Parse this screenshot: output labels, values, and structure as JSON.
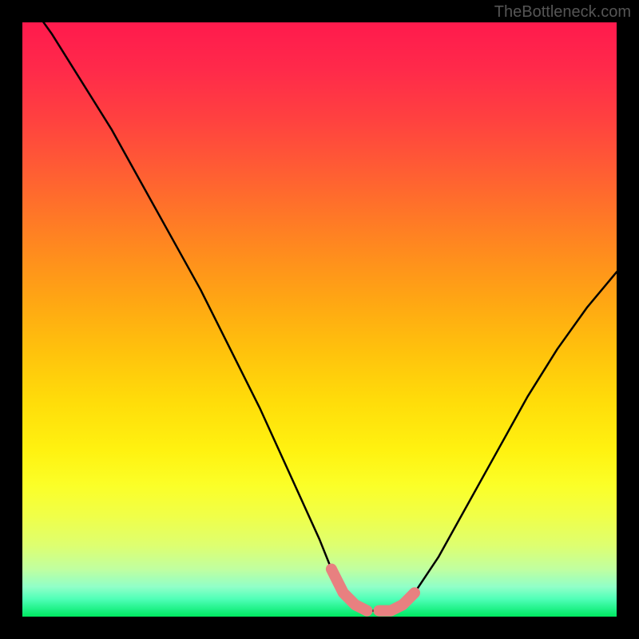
{
  "attribution": "TheBottleneck.com",
  "chart_data": {
    "type": "line",
    "title": "",
    "xlabel": "",
    "ylabel": "",
    "xlim": [
      0,
      100
    ],
    "ylim": [
      0,
      100
    ],
    "series": [
      {
        "name": "bottleneck-curve",
        "x": [
          0,
          5,
          10,
          15,
          20,
          25,
          30,
          35,
          40,
          45,
          50,
          52,
          54,
          56,
          58,
          60,
          62,
          64,
          66,
          70,
          75,
          80,
          85,
          90,
          95,
          100
        ],
        "values": [
          105,
          98,
          90,
          82,
          73,
          64,
          55,
          45,
          35,
          24,
          13,
          8,
          4,
          2,
          1,
          1,
          1,
          2,
          4,
          10,
          19,
          28,
          37,
          45,
          52,
          58
        ]
      },
      {
        "name": "optimal-highlight",
        "x": [
          52,
          54,
          56,
          58,
          60,
          62,
          64,
          66
        ],
        "values": [
          8,
          4,
          2,
          1,
          1,
          1,
          2,
          4
        ]
      }
    ],
    "optimal_x": 59,
    "colors": {
      "curve": "#000000",
      "highlight": "#e88080",
      "background_top": "#ff1a4d",
      "background_bottom": "#00e860"
    }
  }
}
